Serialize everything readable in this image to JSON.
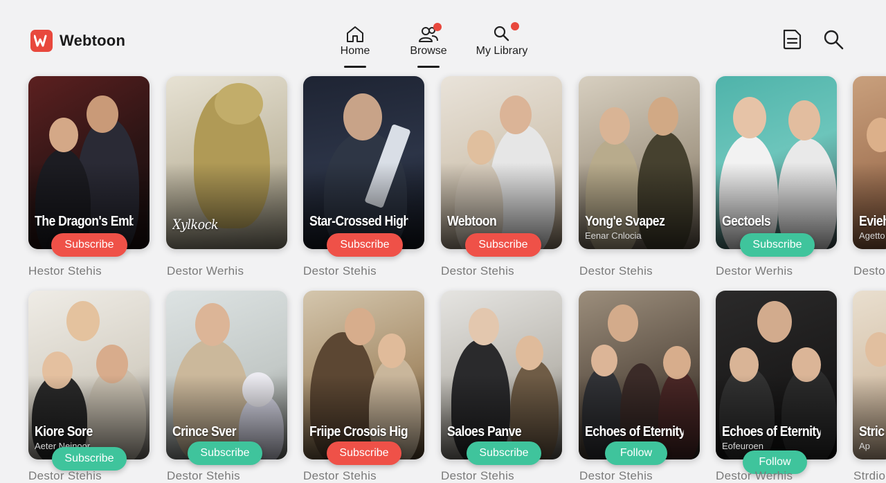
{
  "app": {
    "name": "Webtoon",
    "brand_color": "#e8483d"
  },
  "nav": {
    "tabs": [
      {
        "label": "Home",
        "icon": "home-icon",
        "active": true,
        "badge": false
      },
      {
        "label": "Browse",
        "icon": "people-icon",
        "active": true,
        "badge": true
      },
      {
        "label": "My Library",
        "icon": "search-icon",
        "active": false,
        "badge": true
      }
    ]
  },
  "header_actions": [
    {
      "icon": "document-icon"
    },
    {
      "icon": "search-icon"
    }
  ],
  "rows": [
    [
      {
        "title": "The Dragon's Embrace",
        "subtitle": "",
        "action": "Subscribe",
        "action_color": "red",
        "author": "Hestor  Stehis"
      },
      {
        "title": "",
        "cover_text": "Xylkock",
        "subtitle": "",
        "action": "",
        "action_color": "",
        "author": "Destor Werhis"
      },
      {
        "title": "Star-Crossed High",
        "subtitle": "",
        "action": "Subscribe",
        "action_color": "red",
        "author": "Destor  Stehis"
      },
      {
        "title": "Webtoon",
        "subtitle": "",
        "action": "Subscribe",
        "action_color": "red",
        "author": "Destor  Stehis"
      },
      {
        "title": "Yong'e Svapez",
        "subtitle": "Eenar Cnlocia",
        "action": "",
        "action_color": "",
        "author": "Destor Stehis"
      },
      {
        "title": "Gectoels",
        "subtitle": "",
        "action": "Subscribe",
        "action_color": "green",
        "author": "Destor  Werhis"
      },
      {
        "title": "Evieh",
        "subtitle": "Agetto",
        "action": "",
        "action_color": "",
        "author": "Desto"
      }
    ],
    [
      {
        "title": "Kiore Sore",
        "subtitle": "Aeter Neinoor",
        "action": "Subscribe",
        "action_color": "green",
        "author": "Destor  Stehis"
      },
      {
        "title": "Crince Sver",
        "subtitle": "",
        "action": "Subscribe",
        "action_color": "green",
        "author": "Destor  Stehis"
      },
      {
        "title": "Friipe Crosois High",
        "subtitle": "",
        "action": "Subscribe",
        "action_color": "red",
        "author": "Destor  Stehis"
      },
      {
        "title": "Saloes Panve",
        "subtitle": "",
        "action": "Subscribe",
        "action_color": "green",
        "author": "Destor  Stehis"
      },
      {
        "title": "Echoes of Eternity",
        "subtitle": "",
        "action": "Follow",
        "action_color": "green",
        "author": "Destor Stehis"
      },
      {
        "title": "Echoes of Eternity",
        "subtitle": "Eofeuroen",
        "action": "Follow",
        "action_color": "green",
        "author": "Destor  Werhis"
      },
      {
        "title": "Stric",
        "subtitle": "Ap",
        "action": "",
        "action_color": "",
        "author": "Strdior"
      }
    ]
  ]
}
